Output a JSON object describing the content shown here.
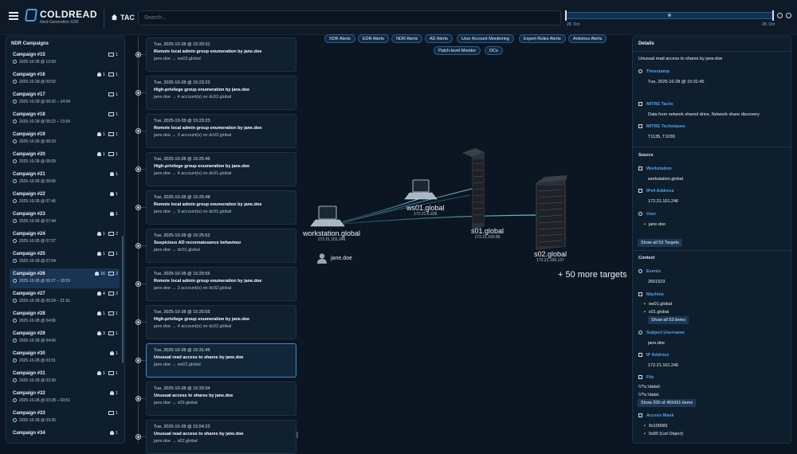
{
  "app": {
    "brand": "COLDREAD",
    "brand_sub": "Next-Generation XDR",
    "section": "TAC",
    "search_placeholder": "Search...",
    "timeline_start": "28. Oct",
    "timeline_end": "28. Oct",
    "accent": "#3fa0e8"
  },
  "campaigns": {
    "title": "NDR Campaigns",
    "items": [
      {
        "name": "Campaign #15",
        "date": "2025-10-28 @ 12:59",
        "users": "",
        "machines": "1"
      },
      {
        "name": "Campaign #16",
        "date": "2025-10-28 @ 09:02",
        "users": "1",
        "machines": "1"
      },
      {
        "name": "Campaign #17",
        "date": "2025-10-28 @ 08:32 – 14:04",
        "users": "",
        "machines": "1"
      },
      {
        "name": "Campaign #18",
        "date": "2025-10-28 @ 08:22 – 13:54",
        "users": "",
        "machines": "1"
      },
      {
        "name": "Campaign #19",
        "date": "2025-10-28 @ 08:10",
        "users": "1",
        "machines": "1"
      },
      {
        "name": "Campaign #20",
        "date": "2025-10-28 @ 08:09",
        "users": "1",
        "machines": "1"
      },
      {
        "name": "Campaign #21",
        "date": "2025-10-28 @ 08:06",
        "users": "1",
        "machines": ""
      },
      {
        "name": "Campaign #22",
        "date": "2025-10-28 @ 07:46",
        "users": "1",
        "machines": ""
      },
      {
        "name": "Campaign #23",
        "date": "2025-10-28 @ 07:44",
        "users": "1",
        "machines": ""
      },
      {
        "name": "Campaign #24",
        "date": "2025-10-28 @ 07:37",
        "users": "1",
        "machines": "2"
      },
      {
        "name": "Campaign #25",
        "date": "2025-10-28 @ 07:04",
        "users": "1",
        "machines": "1"
      },
      {
        "name": "Campaign #26",
        "date": "2025-10-28 @ 06:27 – 18:53",
        "users": "16",
        "machines": "2",
        "active": true
      },
      {
        "name": "Campaign #27",
        "date": "2025-10-28 @ 05:24 – 21:51",
        "users": "4",
        "machines": "2"
      },
      {
        "name": "Campaign #28",
        "date": "2025-10-28 @ 04:06",
        "users": "1",
        "machines": "1"
      },
      {
        "name": "Campaign #29",
        "date": "2025-10-28 @ 04:06",
        "users": "3",
        "machines": "1"
      },
      {
        "name": "Campaign #30",
        "date": "2025-10-28 @ 03:31",
        "users": "1",
        "machines": ""
      },
      {
        "name": "Campaign #31",
        "date": "2025-10-28 @ 03:30",
        "users": "1",
        "machines": "1"
      },
      {
        "name": "Campaign #32",
        "date": "2025-10-28 @ 03:28 – 03:51",
        "users": "1",
        "machines": ""
      },
      {
        "name": "Campaign #33",
        "date": "2025-10-28 @ 03:26",
        "users": "",
        "machines": "1"
      },
      {
        "name": "Campaign #34",
        "date": "",
        "users": "1",
        "machines": ""
      }
    ]
  },
  "events": [
    {
      "time": "Tue, 2025-10-28 @ 15:20:31",
      "title": "Remote local admin group enumeration by jane.doe",
      "sub": "jane.doe → ws02.global"
    },
    {
      "time": "Tue, 2025-10-28 @ 15:23:22",
      "title": "High-privilege group enumeration by jane.doe",
      "sub": "jane.doe → 4 account(s) on dc02.global"
    },
    {
      "time": "Tue, 2025-10-28 @ 15:23:23",
      "title": "Remote local admin group enumeration by jane.doe",
      "sub": "jane.doe → 3 account(s) on dc02.global"
    },
    {
      "time": "Tue, 2025-10-28 @ 15:25:46",
      "title": "High-privilege group enumeration by jane.doe",
      "sub": "jane.doe → 4 account(s) on dc01.global"
    },
    {
      "time": "Tue, 2025-10-28 @ 15:25:48",
      "title": "Remote local admin group enumeration by jane.doe",
      "sub": "jane.doe → 3 account(s) on dc01.global"
    },
    {
      "time": "Tue, 2025-10-28 @ 15:25:52",
      "title": "Suspicious AD reconnaissance behaviour",
      "sub": "jane.doe → dc01.global"
    },
    {
      "time": "Tue, 2025-10-28 @ 15:25:55",
      "title": "Remote local admin group enumeration by jane.doe",
      "sub": "jane.doe → 3 account(s) on dc02.global"
    },
    {
      "time": "Tue, 2025-10-28 @ 15:25:55",
      "title": "High-privilege group enumeration by jane.doe",
      "sub": "jane.doe → 4 account(s) on dc02.global"
    },
    {
      "time": "Tue, 2025-10-28 @ 15:31:45",
      "title": "Unusual read access to shares by jane.doe",
      "sub": "jane.doe → ws01.global",
      "active": true
    },
    {
      "time": "Tue, 2025-10-28 @ 15:33:34",
      "title": "Unusual access to shares by jane.doe",
      "sub": "jane.doe → s03.global"
    },
    {
      "time": "Tue, 2025-10-28 @ 15:54:22",
      "title": "Unusual read access to shares by jane.doe",
      "sub": "jane.doe → s02.global"
    }
  ],
  "filters": [
    "XDR Alerts",
    "EDR Alerts",
    "NDR Alerts",
    "AD Alerts",
    "User Account Monitoring",
    "Expert Rules Alerts",
    "Antivirus Alerts",
    "Patch-level Monitor",
    "DCs"
  ],
  "graph": {
    "nodes": {
      "workstation": {
        "name": "workstation.global",
        "ip": "172.21.101.246"
      },
      "ws01": {
        "name": "ws01.global",
        "ip": "172.21.6.236"
      },
      "s01": {
        "name": "s01.global",
        "ip": "172.21.100.85"
      },
      "s02": {
        "name": "s02.global",
        "ip": "172.21.100.137"
      }
    },
    "user": "jane.doe",
    "more_targets": "+ 50 more targets"
  },
  "details": {
    "title": "Details",
    "subtitle": "Unusual read access to shares by jane.doe",
    "timestamp_key": "Timestamp",
    "timestamp_val": "Tue, 2025-10-28 @ 15:31:45",
    "tactic_key": "MITRE Tactic",
    "tactic_val": "Data from network shared drive, Network share discovery",
    "tech_key": "MITRE Techniques",
    "tech_val": "T1135, T1039",
    "source_label": "Source",
    "workstation_key": "Workstation",
    "workstation_val": "workstation.global",
    "ipv4_key": "IPv4 Address",
    "ipv4_val": "172.21.101.246",
    "user_key": "User",
    "user_val": "jane.doe",
    "show_targets": "Show all 53 Targets",
    "context_label": "Context",
    "events_key": "Events",
    "events_val": "2651523",
    "machine_key": "Machine",
    "machine_1": "ws01.global",
    "machine_2": "s01.global",
    "show_items": "Show all 53 items",
    "subject_key": "Subject Username",
    "subject_val": "jane.doe",
    "ip_key": "IP Address",
    "ip_val": "172.21.101.246",
    "file_key": "File",
    "file_1": "\\\\?\\c:\\data\\\\",
    "file_2": "\\\\?\\c:\\data\\",
    "show_files": "Show 200 of 455431 items",
    "mask_key": "Access Mask",
    "mask_1": "0x100081",
    "mask_2": "0x80 (List Object)"
  }
}
